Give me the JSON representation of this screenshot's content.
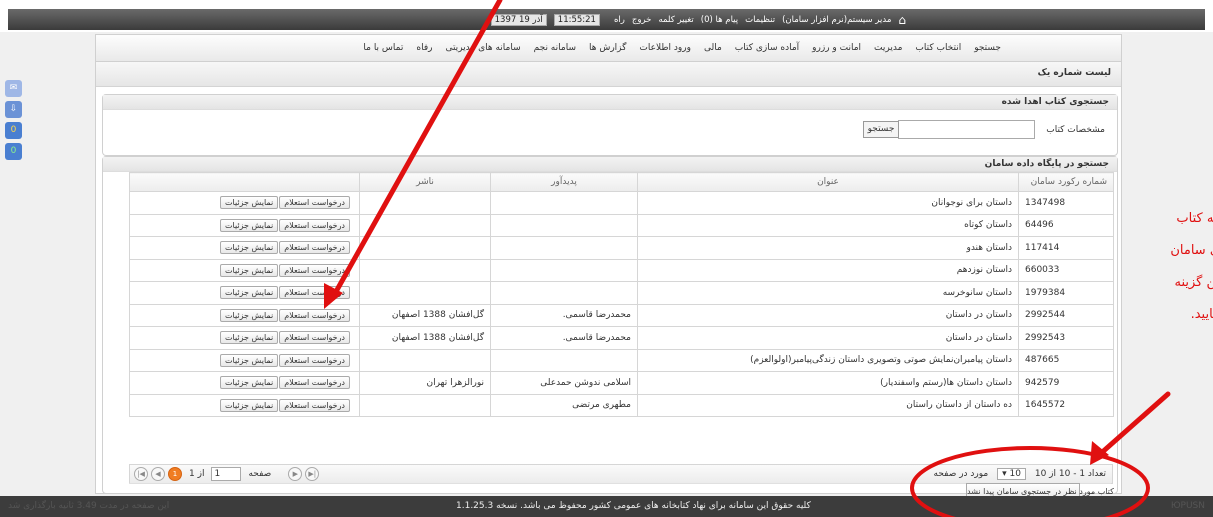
{
  "topbar": {
    "user": "مدیر سیستم(نرم افزار سامان)",
    "settings": "تنظیمات",
    "messages": "پیام ها (0)",
    "change_password": "تغییر کلمه",
    "logout": "خروج",
    "help": "راه",
    "time": "11:55:21",
    "date": "1397 آذر 19"
  },
  "nav": {
    "items": [
      "جستجو",
      "انتخاب کتاب",
      "مدیریت",
      "امانت و رزرو",
      "آماده سازی کتاب",
      "مالی",
      "ورود اطلاعات",
      "گزارش ها",
      "سامانه نجم",
      "سامانه های مدیریتی",
      "رفاه",
      "تماس با ما"
    ]
  },
  "page": {
    "title": "لیست شماره یک"
  },
  "donated": {
    "header": "جستجوی کتاب اهدا شده",
    "label": "مشخصات کتاب",
    "button": "جستجو"
  },
  "saman": {
    "header": "جستجو در پایگاه داده سامان",
    "columns": [
      "شماره رکورد سامان",
      "عنوان",
      "پدیدآور",
      "ناشر",
      ""
    ],
    "rows": [
      {
        "id": "1347498",
        "title": "داستان برای نوجوانان",
        "author": "",
        "publisher": ""
      },
      {
        "id": "64496",
        "title": "داستان کوتاه",
        "author": "",
        "publisher": ""
      },
      {
        "id": "117414",
        "title": "داستان هندو",
        "author": "",
        "publisher": ""
      },
      {
        "id": "660033",
        "title": "داستان نوزدهم",
        "author": "",
        "publisher": ""
      },
      {
        "id": "1979384",
        "title": "داستان سانوخرسه",
        "author": "",
        "publisher": ""
      },
      {
        "id": "2992544",
        "title": "داستان در داستان",
        "author": "محمدرضا قاسمی.",
        "publisher": "گل‌افشان 1388 اصفهان"
      },
      {
        "id": "2992543",
        "title": "داستان در داستان",
        "author": "محمدرضا قاسمی.",
        "publisher": "گل‌افشان 1388 اصفهان"
      },
      {
        "id": "487665",
        "title": "داستان پیامبران‌نمایش صوتی وتصویری داستان زندگی‌پیامبر(اولوالعزم)",
        "author": "",
        "publisher": ""
      },
      {
        "id": "942579",
        "title": "داستان داستان ها(رستم واسفندیار)",
        "author": "اسلامی ندوشن حمدعلی",
        "publisher": "نورالزهرا تهران"
      },
      {
        "id": "1645572",
        "title": "ده داستان از داستان راستان",
        "author": "مطهری مرتضی",
        "publisher": ""
      }
    ],
    "btn_inquiry": "درخواست استعلام",
    "btn_details": "نمایش جزئیات",
    "pager": {
      "summary": "تعداد 1 - 10 از 10",
      "per_page_value": "10",
      "per_page_label": "مورد در صفحه",
      "page_word": "صفحه",
      "page_input": "1",
      "of_total": "از 1",
      "current_page": "1"
    }
  },
  "not_found_button": "کتاب مورد نظر در جستجوی سامان پیدا نشد",
  "annotation_text": [
    "که کتاب",
    "ی سامان",
    "ین گزینه",
    "مایید."
  ],
  "footer": {
    "copyright": "کلیه حقوق این سامانه برای نهاد کتابخانه های عمومی کشور محفوظ می باشد. نسخه 1.1.25.3",
    "left_note": "این صفحه در مدت 3.49 ثانیه بارگذاری شد",
    "right_note": "ЮРUSN"
  },
  "colors": {
    "annotation_red": "#e01010",
    "pager_current": "#f07d22",
    "side_tile": "#4a7fd1"
  },
  "icons": [
    "home-icon",
    "clock-icon",
    "mail-icon",
    "download-icon"
  ]
}
